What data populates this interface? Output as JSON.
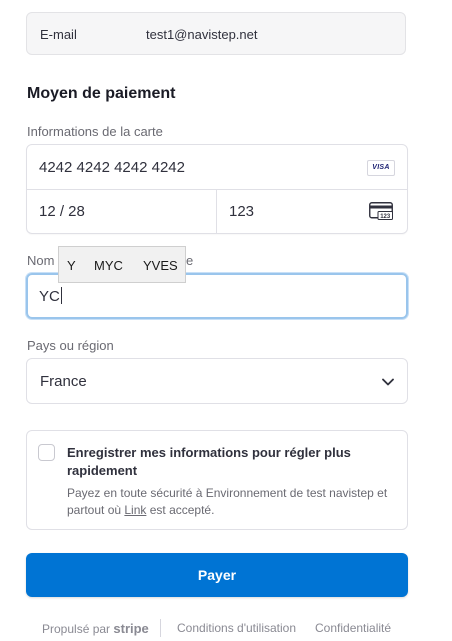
{
  "email": {
    "label": "E-mail",
    "value": "test1@navistep.net"
  },
  "payment_section": {
    "title": "Moyen de paiement"
  },
  "card": {
    "label": "Informations de la carte",
    "number": "4242 4242 4242 4242",
    "brand": "VISA",
    "expiry": "12 / 28",
    "cvc": "123",
    "cvc_icon_text": "123"
  },
  "cardholder": {
    "label_prefix": "Nom",
    "label_suffix": "e",
    "value": "YC"
  },
  "autocomplete": {
    "options": [
      "Y",
      "MYC",
      "YVES"
    ]
  },
  "country": {
    "label": "Pays ou région",
    "value": "France"
  },
  "save_info": {
    "title": "Enregistrer mes informations pour régler plus rapidement",
    "desc_before": "Payez en toute sécurité à Environnement de test navistep et partout où ",
    "desc_link": "Link",
    "desc_after": " est accepté."
  },
  "pay_button": {
    "label": "Payer"
  },
  "footer": {
    "powered_by": "Propulsé par",
    "brand": "stripe",
    "terms": "Conditions d'utilisation",
    "privacy": "Confidentialité"
  },
  "colors": {
    "accent": "#0074d4",
    "focus": "#9ac5ec"
  }
}
